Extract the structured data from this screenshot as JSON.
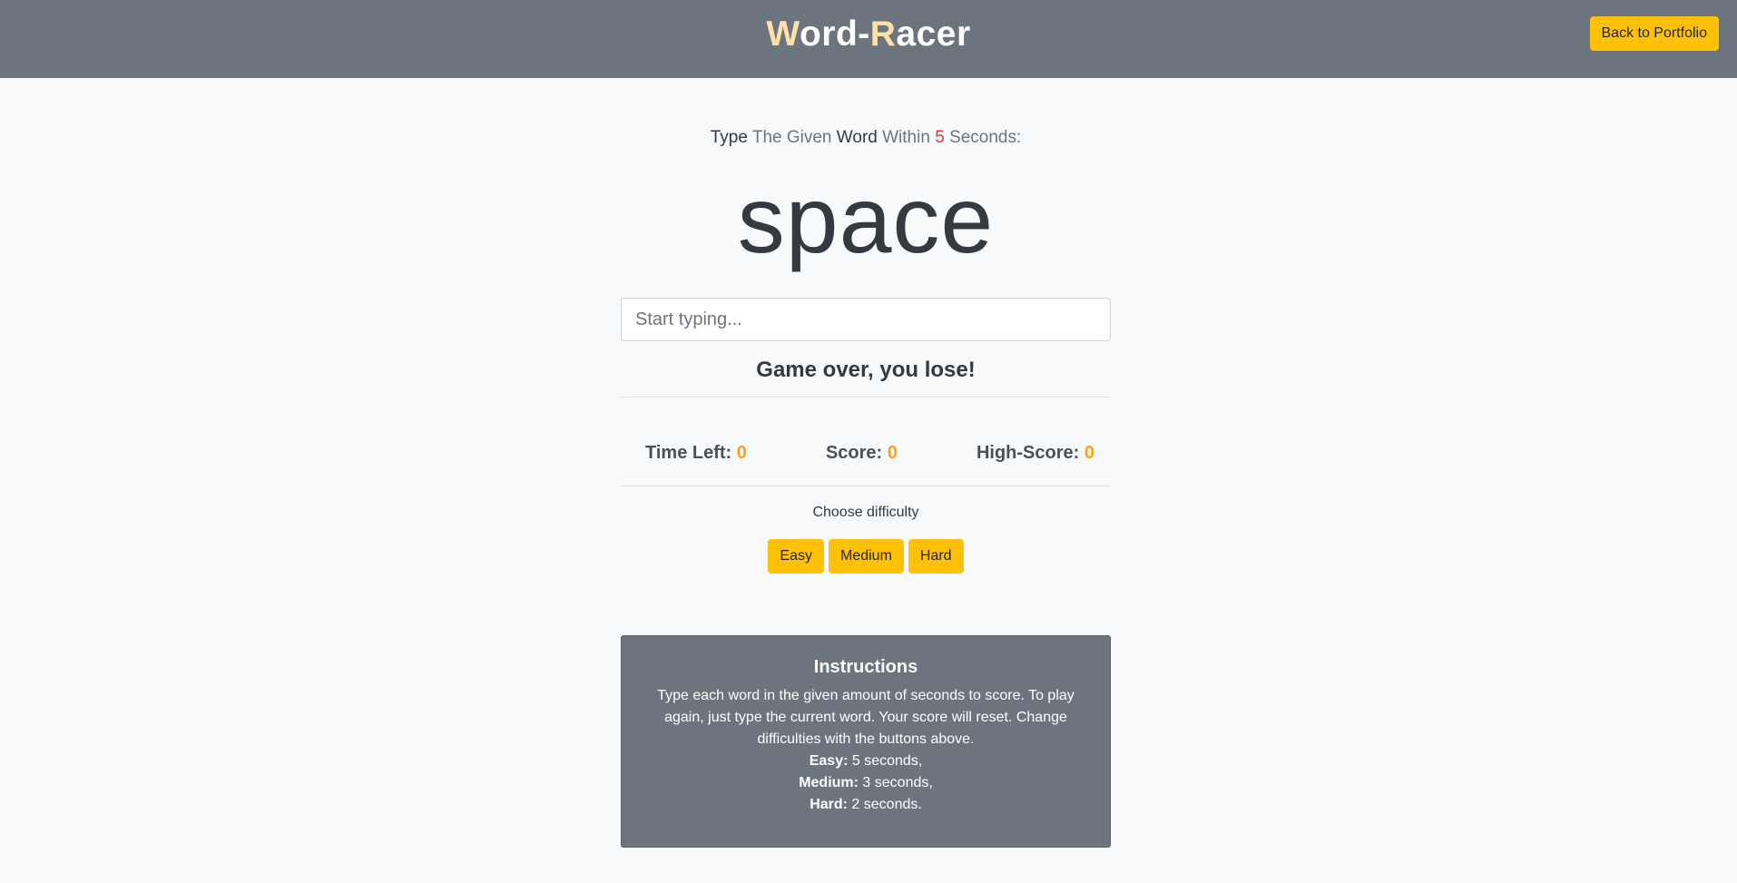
{
  "header": {
    "brand_w": "W",
    "brand_ord": "ord-",
    "brand_r": "R",
    "brand_acer": "acer",
    "back_button": "Back to Portfolio"
  },
  "prompt": {
    "type": "Type",
    "the_given": "The Given",
    "word": "Word",
    "within": "Within",
    "seconds_value": "5",
    "seconds_label": "Seconds:"
  },
  "current_word": "space",
  "input": {
    "placeholder": "Start typing..."
  },
  "message": "Game over, you lose!",
  "stats": {
    "time_left_label": "Time Left:",
    "time_left_value": "0",
    "score_label": "Score:",
    "score_value": "0",
    "high_score_label": "High-Score:",
    "high_score_value": "0"
  },
  "difficulty": {
    "label": "Choose difficulty",
    "easy": "Easy",
    "medium": "Medium",
    "hard": "Hard"
  },
  "instructions": {
    "title": "Instructions",
    "body": "Type each word in the given amount of seconds to score. To play again, just type the current word. Your score will reset. Change difficulties with the buttons above.",
    "easy_label": "Easy:",
    "easy_text": "5 seconds,",
    "medium_label": "Medium:",
    "medium_text": "3 seconds,",
    "hard_label": "Hard:",
    "hard_text": "2 seconds."
  },
  "colors": {
    "navbar": "#6c757d",
    "accent_yellow": "#ffc107",
    "stat_value": "#ffa017",
    "seconds_red": "#dc3545"
  }
}
